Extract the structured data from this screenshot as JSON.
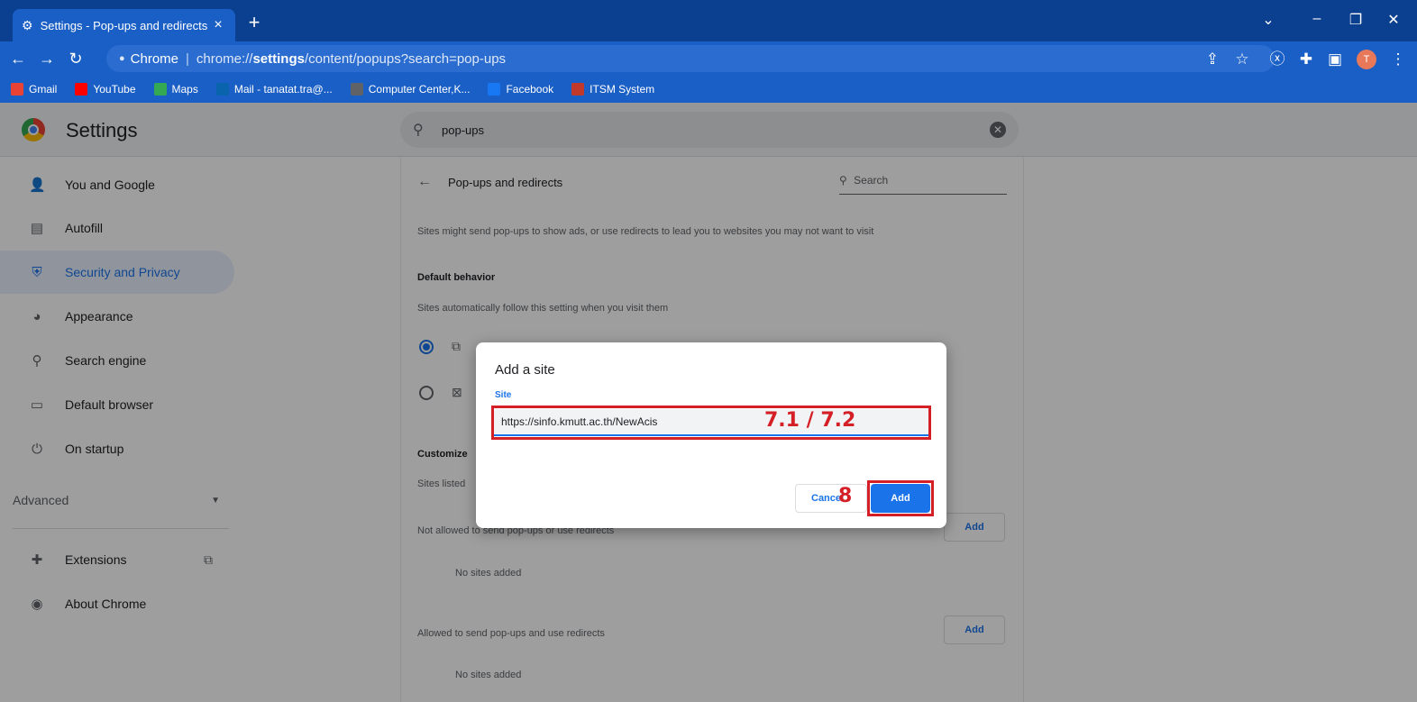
{
  "browser": {
    "tab_title": "Settings - Pop-ups and redirects",
    "tab_close": "×",
    "new_tab": "+",
    "url_origin": "Chrome",
    "url": "chrome://settings/content/popups?search=pop-ups",
    "url_prefix": "chrome://",
    "url_bold": "settings",
    "url_rest": "/content/popups?search=pop-ups",
    "avatar_letter": "T",
    "bookmarks": [
      {
        "label": "Gmail",
        "icon": "gmail-icon",
        "color": "#ea4335"
      },
      {
        "label": "YouTube",
        "icon": "youtube-icon",
        "color": "#ff0000"
      },
      {
        "label": "Maps",
        "icon": "maps-icon",
        "color": "#34a853"
      },
      {
        "label": "Mail - tanatat.tra@...",
        "icon": "outlook-icon",
        "color": "#0a64ad"
      },
      {
        "label": "Computer Center,K...",
        "icon": "globe-icon",
        "color": "#5f6368"
      },
      {
        "label": "Facebook",
        "icon": "facebook-icon",
        "color": "#1877f2"
      },
      {
        "label": "ITSM System",
        "icon": "itsm-icon",
        "color": "#c0392b"
      }
    ]
  },
  "settings": {
    "title": "Settings",
    "search_value": "pop-ups",
    "sidebar": [
      {
        "label": "You and Google",
        "icon": "person-icon"
      },
      {
        "label": "Autofill",
        "icon": "clipboard-icon"
      },
      {
        "label": "Security and Privacy",
        "icon": "shield-icon"
      },
      {
        "label": "Appearance",
        "icon": "palette-icon"
      },
      {
        "label": "Search engine",
        "icon": "search-icon"
      },
      {
        "label": "Default browser",
        "icon": "browser-icon"
      },
      {
        "label": "On startup",
        "icon": "power-icon"
      }
    ],
    "advanced_label": "Advanced",
    "extensions_label": "Extensions",
    "about_label": "About Chrome",
    "page": {
      "heading": "Pop-ups and redirects",
      "search_placeholder": "Search",
      "description": "Sites might send pop-ups to show ads, or use redirects to lead you to websites you may not want to visit",
      "default_behavior": "Default behavior",
      "default_desc": "Sites automatically follow this setting when you visit them",
      "customized_label": "Customize",
      "customized_desc": "Sites listed",
      "not_allowed_label": "Not allowed to send pop-ups or use redirects",
      "allowed_label": "Allowed to send pop-ups and use redirects",
      "no_sites": "No sites added",
      "add_label": "Add"
    }
  },
  "dialog": {
    "title": "Add a site",
    "field_label": "Site",
    "field_value": "https://sinfo.kmutt.ac.th/NewAcis",
    "cancel_label": "Cancel",
    "add_label": "Add",
    "annotation_input": "7.1 / 7.2",
    "annotation_button": "8",
    "annotation_color": "#d41f26"
  }
}
